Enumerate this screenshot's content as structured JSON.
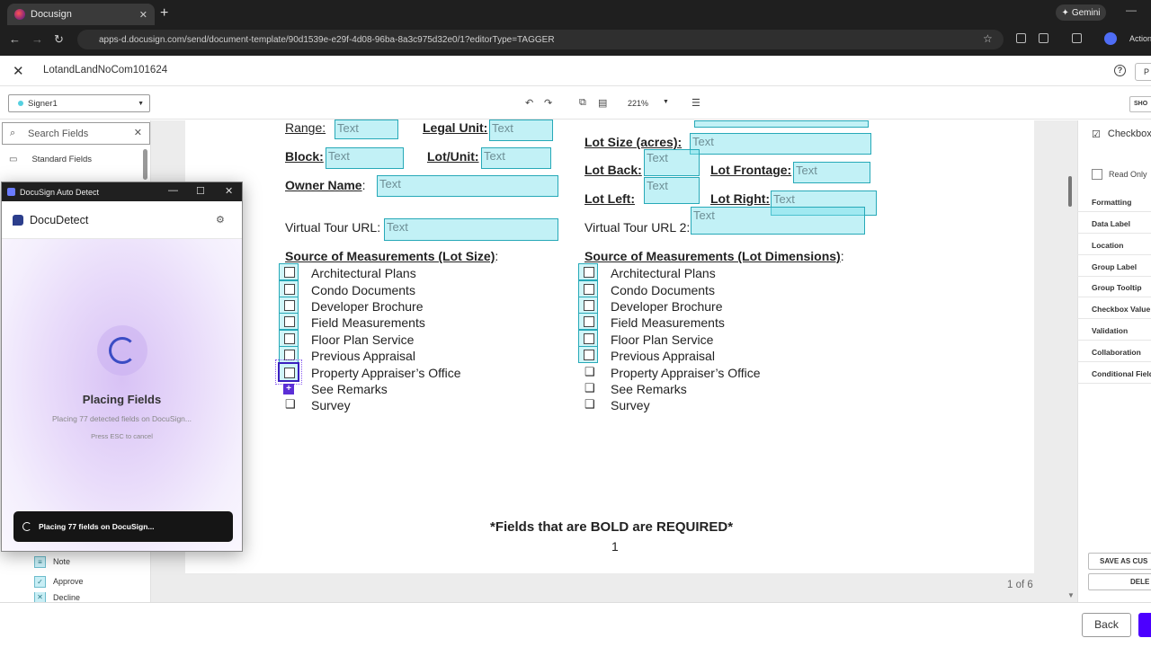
{
  "browser": {
    "tab_title": "Docusign",
    "new_tab": "+",
    "url": "apps-d.docusign.com/send/document-template/90d1539e-e29f-4d08-96ba-8a3c975d32e0/1?editorType=TAGGER",
    "gemini_label": "Gemini",
    "action_label": "Action"
  },
  "header": {
    "doc_name": "LotandLandNoCom101624",
    "help": "?",
    "right_btn": "P"
  },
  "toolbar": {
    "signer": "Signer1",
    "zoom": "221%",
    "show_btn": "SHO"
  },
  "left_panel": {
    "search_placeholder": "Search Fields",
    "standard_fields": "Standard Fields",
    "items": [
      {
        "label": "Note"
      },
      {
        "label": "Approve"
      },
      {
        "label": "Decline"
      }
    ]
  },
  "document": {
    "fields": {
      "range": "Range:",
      "legal_unit": "Legal Unit:",
      "lot_size": "Lot Size (acres):",
      "block": "Block:",
      "lot_unit": "Lot/Unit:",
      "lot_back": "Lot Back:",
      "lot_frontage": "Lot Frontage:",
      "owner_name": "Owner Name",
      "colon": ":",
      "lot_left": "Lot Left:",
      "lot_right": "Lot Right:",
      "virtual_tour": "Virtual Tour URL:",
      "virtual_tour2": "Virtual Tour URL 2:"
    },
    "text_field_placeholder": "Text",
    "source_left": "Source of Measurements (Lot Size)",
    "source_right": "Source of Measurements (Lot Dimensions)",
    "options": [
      "Architectural Plans",
      "Condo Documents",
      "Developer Brochure",
      "Field Measurements",
      "Floor Plan Service",
      "Previous Appraisal",
      "Property Appraiser’s Office",
      "See Remarks",
      "Survey"
    ],
    "required_note": "*Fields that are BOLD are REQUIRED*",
    "page_number": "1",
    "page_of": "1 of 6"
  },
  "right_panel": {
    "title": "Checkbox",
    "read_only": "Read Only",
    "options": [
      "Formatting",
      "Data Label",
      "Location",
      "Group Label",
      "Group Tooltip",
      "Checkbox Value",
      "Validation",
      "Collaboration",
      "Conditional Field"
    ],
    "save_btn": "SAVE AS CUS",
    "delete_btn": "DELE"
  },
  "footer": {
    "back": "Back"
  },
  "auto_detect": {
    "window_title": "DocuSign Auto Detect",
    "app_name": "DocuDetect",
    "status_title": "Placing Fields",
    "status_sub": "Placing 77 detected fields on DocuSign...",
    "esc_hint": "Press ESC to cancel",
    "toast": "Placing 77 fields on DocuSign..."
  }
}
